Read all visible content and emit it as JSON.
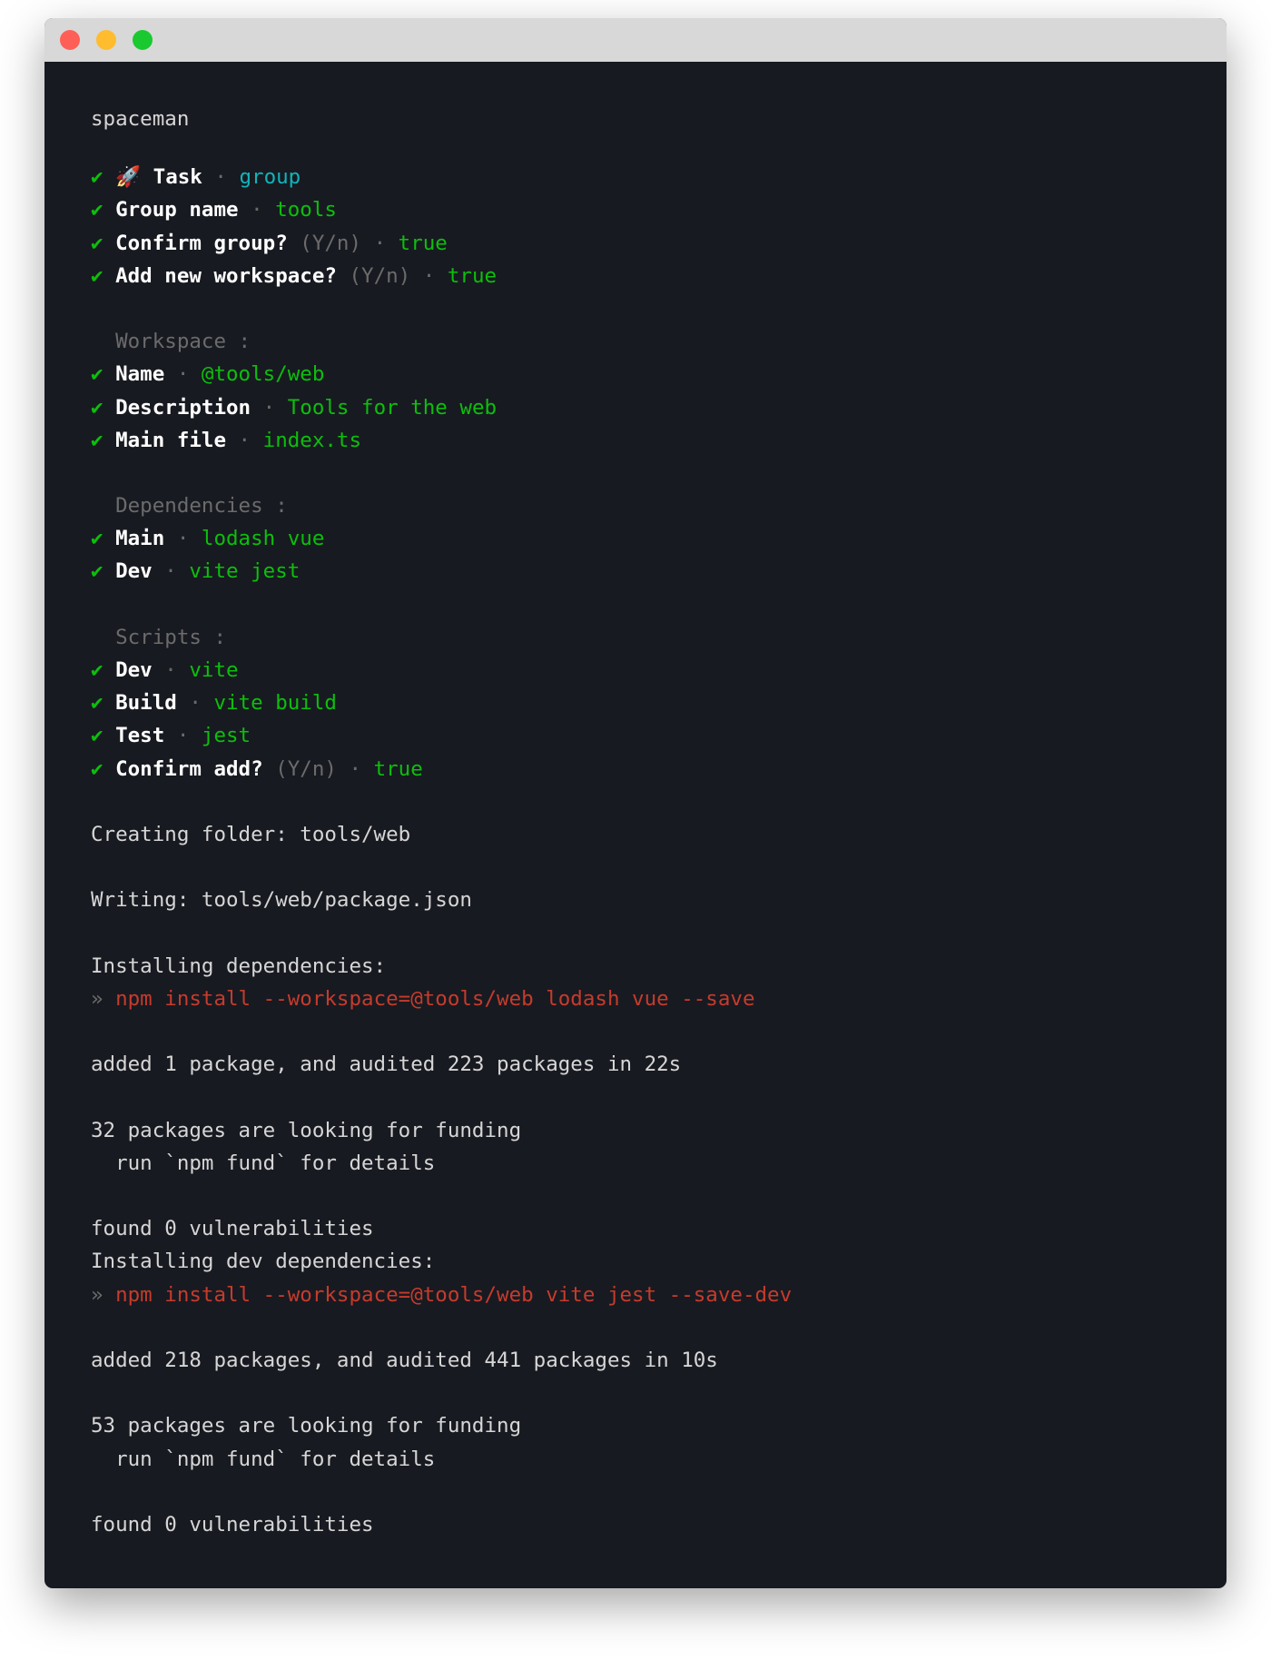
{
  "window": {
    "controls": [
      {
        "name": "close",
        "color": "#fe5f57"
      },
      {
        "name": "minimize",
        "color": "#febc2e"
      },
      {
        "name": "zoom",
        "color": "#1ac930"
      }
    ]
  },
  "colors": {
    "background": "#181a21",
    "text": "#d6d6d6",
    "success": "#0cbf0c",
    "accent": "#10b4bb",
    "command": "#c63b2c",
    "muted": "#6b6b6b"
  },
  "lines": [
    [
      {
        "text": "spaceman",
        "style": "t"
      }
    ],
    [
      {
        "text": "✔ ",
        "style": "chk"
      },
      {
        "text": "🚀 ",
        "style": "t"
      },
      {
        "text": "Task",
        "style": "b"
      },
      {
        "text": " · ",
        "style": "d"
      },
      {
        "text": "group",
        "style": "c"
      }
    ],
    [
      {
        "text": "✔ ",
        "style": "chk"
      },
      {
        "text": "Group name",
        "style": "b"
      },
      {
        "text": " · ",
        "style": "d"
      },
      {
        "text": "tools",
        "style": "g"
      }
    ],
    [
      {
        "text": "✔ ",
        "style": "chk"
      },
      {
        "text": "Confirm group?",
        "style": "b"
      },
      {
        "text": " (Y/n) · ",
        "style": "d"
      },
      {
        "text": "true",
        "style": "g"
      }
    ],
    [
      {
        "text": "✔ ",
        "style": "chk"
      },
      {
        "text": "Add new workspace?",
        "style": "b"
      },
      {
        "text": " (Y/n) · ",
        "style": "d"
      },
      {
        "text": "true",
        "style": "g"
      }
    ],
    [],
    [
      {
        "text": "  Workspace :",
        "style": "d"
      }
    ],
    [
      {
        "text": "✔ ",
        "style": "chk"
      },
      {
        "text": "Name",
        "style": "b"
      },
      {
        "text": " · ",
        "style": "d"
      },
      {
        "text": "@tools/web",
        "style": "g"
      }
    ],
    [
      {
        "text": "✔ ",
        "style": "chk"
      },
      {
        "text": "Description",
        "style": "b"
      },
      {
        "text": " · ",
        "style": "d"
      },
      {
        "text": "Tools for the web",
        "style": "g"
      }
    ],
    [
      {
        "text": "✔ ",
        "style": "chk"
      },
      {
        "text": "Main file",
        "style": "b"
      },
      {
        "text": " · ",
        "style": "d"
      },
      {
        "text": "index.ts",
        "style": "g"
      }
    ],
    [],
    [
      {
        "text": "  Dependencies :",
        "style": "d"
      }
    ],
    [
      {
        "text": "✔ ",
        "style": "chk"
      },
      {
        "text": "Main",
        "style": "b"
      },
      {
        "text": " · ",
        "style": "d"
      },
      {
        "text": "lodash vue",
        "style": "g"
      }
    ],
    [
      {
        "text": "✔ ",
        "style": "chk"
      },
      {
        "text": "Dev",
        "style": "b"
      },
      {
        "text": " · ",
        "style": "d"
      },
      {
        "text": "vite jest",
        "style": "g"
      }
    ],
    [],
    [
      {
        "text": "  Scripts :",
        "style": "d"
      }
    ],
    [
      {
        "text": "✔ ",
        "style": "chk"
      },
      {
        "text": "Dev",
        "style": "b"
      },
      {
        "text": " · ",
        "style": "d"
      },
      {
        "text": "vite",
        "style": "g"
      }
    ],
    [
      {
        "text": "✔ ",
        "style": "chk"
      },
      {
        "text": "Build",
        "style": "b"
      },
      {
        "text": " · ",
        "style": "d"
      },
      {
        "text": "vite build",
        "style": "g"
      }
    ],
    [
      {
        "text": "✔ ",
        "style": "chk"
      },
      {
        "text": "Test",
        "style": "b"
      },
      {
        "text": " · ",
        "style": "d"
      },
      {
        "text": "jest",
        "style": "g"
      }
    ],
    [
      {
        "text": "✔ ",
        "style": "chk"
      },
      {
        "text": "Confirm add?",
        "style": "b"
      },
      {
        "text": " (Y/n) · ",
        "style": "d"
      },
      {
        "text": "true",
        "style": "g"
      }
    ],
    [],
    [
      {
        "text": "Creating folder: tools/web",
        "style": "t"
      }
    ],
    [],
    [
      {
        "text": "Writing: tools/web/package.json",
        "style": "t"
      }
    ],
    [],
    [
      {
        "text": "Installing dependencies:",
        "style": "t"
      }
    ],
    [
      {
        "text": "» ",
        "style": "d"
      },
      {
        "text": "npm install --workspace=@tools/web lodash vue --save",
        "style": "r"
      }
    ],
    [],
    [
      {
        "text": "added 1 package, and audited 223 packages in 22s",
        "style": "t"
      }
    ],
    [],
    [
      {
        "text": "32 packages are looking for funding",
        "style": "t"
      }
    ],
    [
      {
        "text": "  run `npm fund` for details",
        "style": "t"
      }
    ],
    [],
    [
      {
        "text": "found 0 vulnerabilities",
        "style": "t"
      }
    ],
    [
      {
        "text": "Installing dev dependencies:",
        "style": "t"
      }
    ],
    [
      {
        "text": "» ",
        "style": "d"
      },
      {
        "text": "npm install --workspace=@tools/web vite jest --save-dev",
        "style": "r"
      }
    ],
    [],
    [
      {
        "text": "added 218 packages, and audited 441 packages in 10s",
        "style": "t"
      }
    ],
    [],
    [
      {
        "text": "53 packages are looking for funding",
        "style": "t"
      }
    ],
    [
      {
        "text": "  run `npm fund` for details",
        "style": "t"
      }
    ],
    [],
    [
      {
        "text": "found 0 vulnerabilities",
        "style": "t"
      }
    ]
  ]
}
